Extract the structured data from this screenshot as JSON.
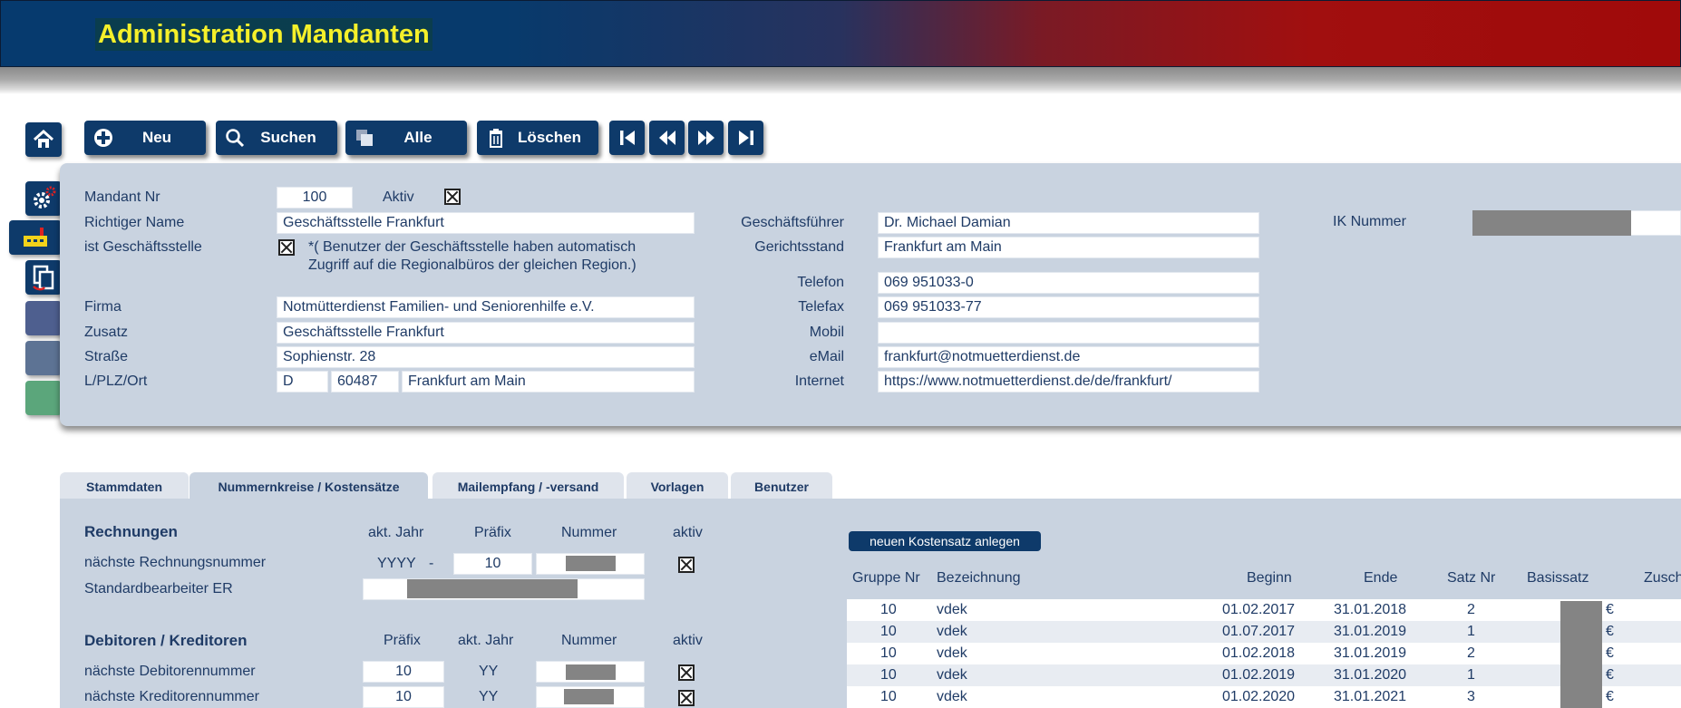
{
  "header": {
    "title": "Administration Mandanten"
  },
  "toolbar": {
    "new_label": "Neu",
    "search_label": "Suchen",
    "all_label": "Alle",
    "delete_label": "Löschen"
  },
  "form": {
    "mandant_nr_label": "Mandant Nr",
    "mandant_nr": "100",
    "aktiv_label": "Aktiv",
    "richtiger_name_label": "Richtiger Name",
    "richtiger_name": "Geschäftsstelle Frankfurt",
    "ist_gs_label": "ist Geschäftsstelle",
    "ist_gs_note_1": "*( Benutzer der Geschäftsstelle haben automatisch",
    "ist_gs_note_2": "Zugriff auf die Regionalbüros der gleichen Region.)",
    "firma_label": "Firma",
    "firma": "Notmütterdienst Familien- und Seniorenhilfe e.V.",
    "zusatz_label": "Zusatz",
    "zusatz": "Geschäftsstelle Frankfurt",
    "strasse_label": "Straße",
    "strasse": "Sophienstr. 28",
    "lplzort_label": "L/PLZ/Ort",
    "land": "D",
    "plz": "60487",
    "ort": "Frankfurt am Main",
    "gf_label": "Geschäftsführer",
    "gf": "Dr. Michael Damian",
    "gericht_label": "Gerichtsstand",
    "gericht": "Frankfurt am Main",
    "telefon_label": "Telefon",
    "telefon": "069 951033-0",
    "telefax_label": "Telefax",
    "telefax": "069 951033-77",
    "mobil_label": "Mobil",
    "mobil": "",
    "email_label": "eMail",
    "email": "frankfurt@notmuetterdienst.de",
    "internet_label": "Internet",
    "internet": "https://www.notmuetterdienst.de/de/frankfurt/",
    "ik_label": "IK Nummer"
  },
  "tabs": [
    {
      "label": "Stammdaten"
    },
    {
      "label": "Nummernkreise / Kostensätze"
    },
    {
      "label": "Mailempfang / -versand"
    },
    {
      "label": "Vorlagen"
    },
    {
      "label": "Benutzer"
    }
  ],
  "rechnungen": {
    "title": "Rechnungen",
    "col_year": "akt. Jahr",
    "col_prefix": "Präfix",
    "col_number": "Nummer",
    "col_active": "aktiv",
    "next_label": "nächste Rechnungsnummer",
    "year_value": "YYYY",
    "dash": "-",
    "prefix_value": "10",
    "std_label": "Standardbearbeiter ER"
  },
  "debitoren": {
    "title": "Debitoren / Kreditoren",
    "col_prefix": "Präfix",
    "col_year": "akt. Jahr",
    "col_number": "Nummer",
    "col_active": "aktiv",
    "deb_label": "nächste Debitorennummer",
    "deb_prefix": "10",
    "deb_year": "YY",
    "kred_label": "nächste Kreditorennummer",
    "kred_prefix": "10",
    "kred_year": "YY"
  },
  "rates": {
    "new_button": "neuen Kostensatz anlegen",
    "headers": {
      "gruppe": "Gruppe Nr",
      "bez": "Bezeichnung",
      "beginn": "Beginn",
      "ende": "Ende",
      "satz": "Satz Nr",
      "basis": "Basissatz",
      "zusch": "Zusch"
    },
    "rows": [
      {
        "gruppe": "10",
        "bez": "vdek",
        "beginn": "01.02.2017",
        "ende": "31.01.2018",
        "satz": "2",
        "cur": "€"
      },
      {
        "gruppe": "10",
        "bez": "vdek",
        "beginn": "01.07.2017",
        "ende": "31.01.2019",
        "satz": "1",
        "cur": "€"
      },
      {
        "gruppe": "10",
        "bez": "vdek",
        "beginn": "01.02.2018",
        "ende": "31.01.2019",
        "satz": "2",
        "cur": "€"
      },
      {
        "gruppe": "10",
        "bez": "vdek",
        "beginn": "01.02.2019",
        "ende": "31.01.2020",
        "satz": "1",
        "cur": "€"
      },
      {
        "gruppe": "10",
        "bez": "vdek",
        "beginn": "01.02.2020",
        "ende": "31.01.2021",
        "satz": "3",
        "cur": "€"
      }
    ]
  }
}
